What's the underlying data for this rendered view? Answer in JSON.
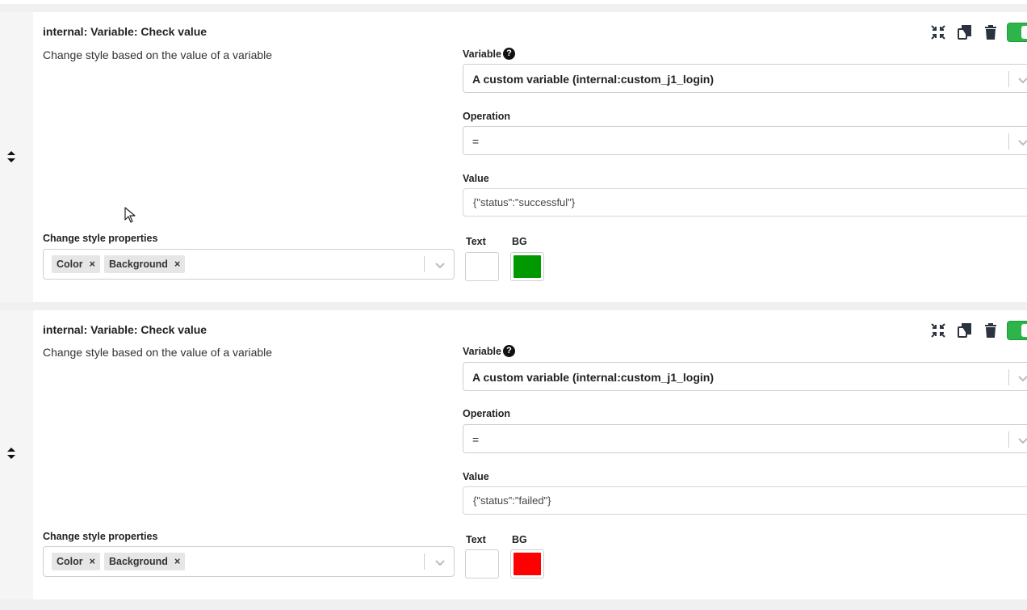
{
  "cards": [
    {
      "title": "internal: Variable: Check value",
      "description": "Change style based on the value of a variable",
      "variable_label": "Variable",
      "variable_value": "A custom variable (internal:custom_j1_login)",
      "operation_label": "Operation",
      "operation_value": "=",
      "value_label": "Value",
      "value_text": "{\"status\":\"successful\"}",
      "style_props_label": "Change style properties",
      "tags": [
        "Color",
        "Background"
      ],
      "text_label": "Text",
      "bg_label": "BG",
      "text_color": "#ffffff",
      "bg_color": "#009900",
      "enabled": true
    },
    {
      "title": "internal: Variable: Check value",
      "description": "Change style based on the value of a variable",
      "variable_label": "Variable",
      "variable_value": "A custom variable (internal:custom_j1_login)",
      "operation_label": "Operation",
      "operation_value": "=",
      "value_label": "Value",
      "value_text": "{\"status\":\"failed\"}",
      "style_props_label": "Change style properties",
      "tags": [
        "Color",
        "Background"
      ],
      "text_label": "Text",
      "bg_label": "BG",
      "text_color": "#ffffff",
      "bg_color": "#ff0000",
      "enabled": true
    }
  ],
  "icons": {
    "help": "?",
    "tag_remove": "×"
  },
  "colors": {
    "toggle_on": "#2db44a"
  }
}
